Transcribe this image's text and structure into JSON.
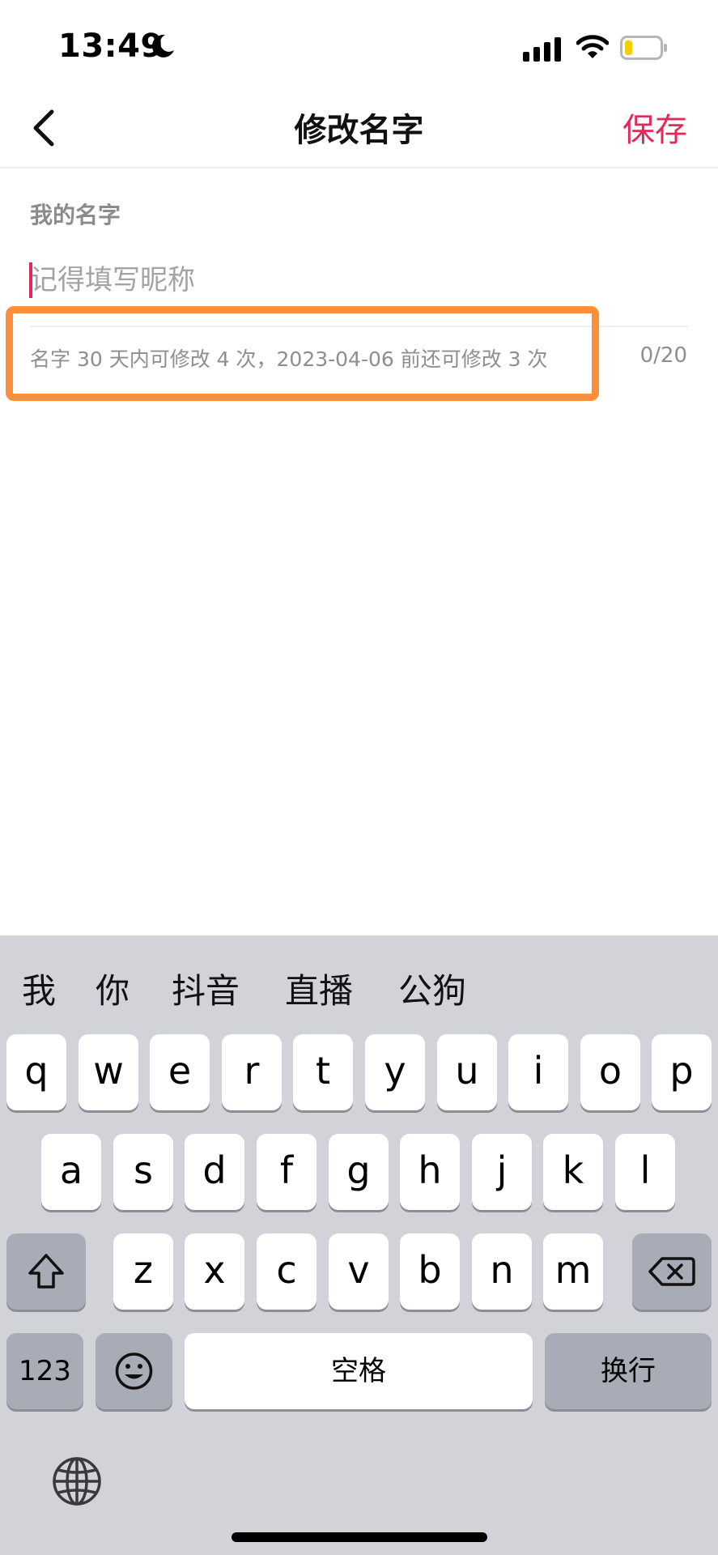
{
  "status_bar": {
    "time": "13:49"
  },
  "header": {
    "title": "修改名字",
    "save_label": "保存"
  },
  "form": {
    "label": "我的名字",
    "placeholder": "记得填写昵称",
    "value": "",
    "hint": "名字 30 天内可修改 4 次，2023-04-06 前还可修改 3 次",
    "counter": "0/20"
  },
  "keyboard": {
    "candidates": [
      "我",
      "你",
      "抖音",
      "直播",
      "公狗"
    ],
    "row1": [
      "q",
      "w",
      "e",
      "r",
      "t",
      "y",
      "u",
      "i",
      "o",
      "p"
    ],
    "row2": [
      "a",
      "s",
      "d",
      "f",
      "g",
      "h",
      "j",
      "k",
      "l"
    ],
    "row3": [
      "z",
      "x",
      "c",
      "v",
      "b",
      "n",
      "m"
    ],
    "numbers_label": "123",
    "space_label": "空格",
    "return_label": "换行"
  },
  "colors": {
    "accent": "#e2295a",
    "highlight": "#fb8f3c",
    "keyboard_bg": "#d1d3d9"
  },
  "icons": [
    "moon-icon",
    "signal-icon",
    "wifi-icon",
    "battery-icon",
    "back-icon",
    "shift-icon",
    "delete-icon",
    "emoji-icon",
    "globe-icon"
  ]
}
